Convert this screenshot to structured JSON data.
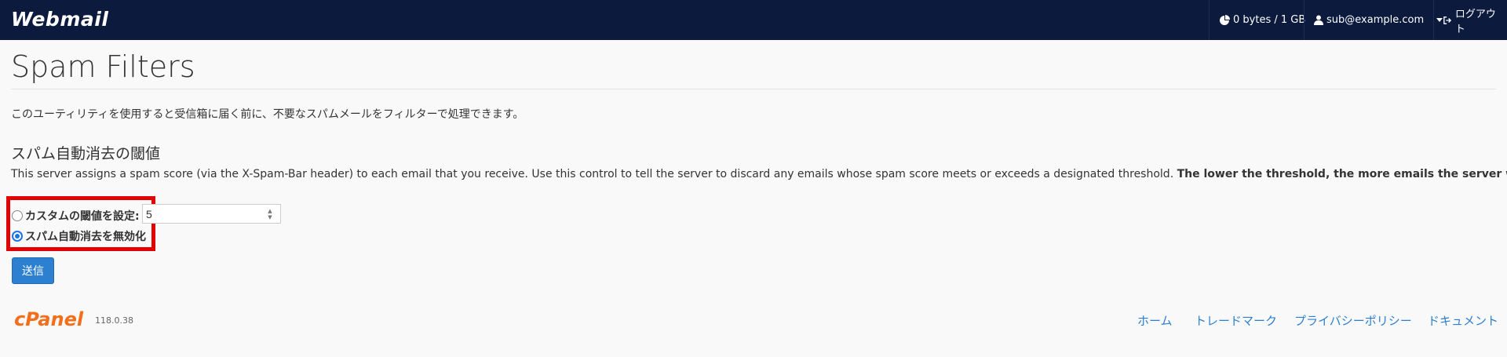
{
  "header": {
    "brand": "Webmail",
    "disk_usage": "0 bytes / 1 GB",
    "user": "sub@example.com",
    "logout": "ログアウト"
  },
  "page": {
    "title": "Spam Filters",
    "intro": "このユーティリティを使用すると受信箱に届く前に、不要なスパムメールをフィルターで処理できます。"
  },
  "section": {
    "title": "スパム自動消去の閾値",
    "desc": "This server assigns a spam score (via the X-Spam-Bar header) to each email that you receive. Use this control to tell the server to discard any emails whose spam score meets or exceeds a designated threshold.",
    "desc_bold": "The lower the threshold, the more emails the server will discard."
  },
  "form": {
    "option_custom_label": "カスタムの閾値を設定:",
    "custom_value": "5",
    "option_disable_label": "スパム自動消去を無効化",
    "selected": "disable",
    "submit_label": "送信"
  },
  "footer": {
    "logo": "cPanel",
    "version": "118.0.38",
    "links": [
      "ホーム",
      "トレードマーク",
      "プライバシーポリシー",
      "ドキュメント"
    ]
  },
  "colors": {
    "nav_bg": "#0b1a3d",
    "primary": "#2d7fcf",
    "highlight": "#e30000",
    "cpanel_orange": "#f36f1b"
  }
}
